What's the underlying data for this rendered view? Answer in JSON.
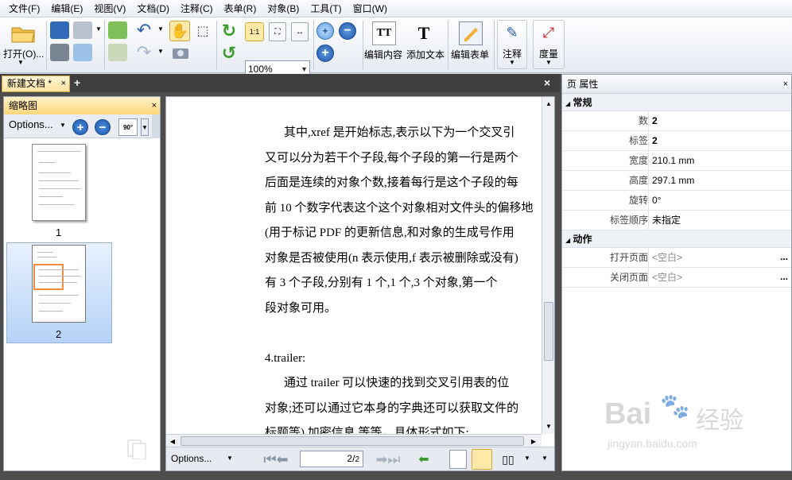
{
  "menu": [
    "文件(F)",
    "编辑(E)",
    "视图(V)",
    "文档(D)",
    "注释(C)",
    "表单(R)",
    "对象(B)",
    "工具(T)",
    "窗口(W)"
  ],
  "toolbar": {
    "open_label": "打开(O)...",
    "zoom_value": "100%",
    "edit_content": "编辑内容",
    "add_text": "添加文本",
    "edit_form": "编辑表单",
    "annotate": "注释",
    "measure": "度量",
    "fit_label": "1:1"
  },
  "tab": {
    "title": "新建文档 *",
    "close": "×",
    "add": "+",
    "doc_close": "×"
  },
  "thumbs": {
    "title": "缩略图",
    "close": "×",
    "options": "Options...",
    "rotate": "90°",
    "page1": "1",
    "page2": "2"
  },
  "document": {
    "lines": [
      "其中,xref 是开始标志,表示以下为一个交叉引",
      "又可以分为若干个子段,每个子段的第一行是两个",
      "后面是连续的对象个数,接着每行是这个子段的每",
      "前 10 个数字代表这个这个对象相对文件头的偏移地",
      "(用于标记 PDF 的更新信息,和对象的生成号作用",
      "对象是否被使用(n 表示使用,f 表示被删除或没有)",
      "有 3 个子段,分别有 1 个,1 个,3 个对象,第一个",
      "段对象可用。",
      "",
      "4.trailer:",
      "通过 trailer 可以快速的找到交叉引用表的位",
      "对象;还可以通过它本身的字典还可以获取文件的",
      "标题等),加密信息,等等。具体形式如下:"
    ]
  },
  "nav": {
    "options": "Options...",
    "page_value": "2/",
    "page_total": "2"
  },
  "props": {
    "title": "页 属性",
    "close": "×",
    "section_general": "常规",
    "section_actions": "动作",
    "rows": [
      {
        "k": "数",
        "v": "2",
        "bold": true
      },
      {
        "k": "标签",
        "v": "2",
        "bold": true
      },
      {
        "k": "宽度",
        "v": "210.1 mm"
      },
      {
        "k": "高度",
        "v": "297.1 mm"
      },
      {
        "k": "旋转",
        "v": "0°"
      },
      {
        "k": "标签顺序",
        "v": "未指定"
      }
    ],
    "action_rows": [
      {
        "k": "打开页面",
        "v": "<空白>"
      },
      {
        "k": "关闭页面",
        "v": "<空白>"
      }
    ],
    "dots": "..."
  },
  "watermark": {
    "brand": "Bai",
    "brand2": "经验",
    "url": "jingyan.baidu.com"
  },
  "colors": {
    "tab_active": "#ffe3a0",
    "selection": "#b5d2f6",
    "thumb_box": "#f08a3c"
  }
}
